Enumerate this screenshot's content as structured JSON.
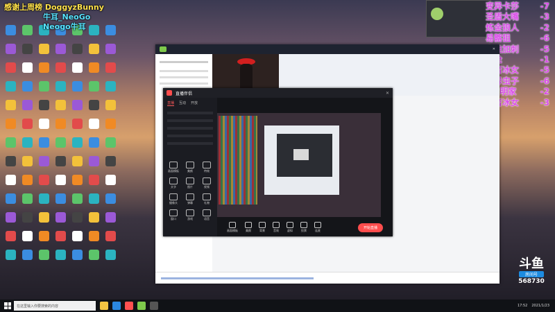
{
  "overlay": {
    "line1": "感谢上周榜 DoggyzBunny",
    "line2": "牛耳_NeoGo",
    "line3": "Neogo牛耳"
  },
  "ranking": [
    {
      "name": "变异卡莎",
      "score": "-7"
    },
    {
      "name": "圣盾大嘴",
      "score": "-3"
    },
    {
      "name": "炼金狼人",
      "score": "-2"
    },
    {
      "name": "易髂狙",
      "score": "-6"
    },
    {
      "name": "辛迪加刺",
      "score": "-5"
    },
    {
      "name": "斗枪",
      "score": "-1"
    },
    {
      "name": "学者冰女",
      "score": "-5"
    },
    {
      "name": "变异虫子",
      "score": "-6"
    },
    {
      "name": "7发明家",
      "score": "-2"
    },
    {
      "name": "学者冰女",
      "score": "-3"
    }
  ],
  "live_app": {
    "title": "直播伴侣",
    "tabs": [
      "直播",
      "互动",
      "开放"
    ],
    "tools": [
      "画面模板",
      "美颜",
      "特效",
      "文字",
      "图片",
      "视频",
      "摄像头",
      "弹幕",
      "礼物",
      "窗口",
      "游戏",
      "语音"
    ],
    "bottom_items": [
      "画面模板",
      "美颜",
      "背景",
      "音效",
      "虚拟",
      "投票",
      "连麦"
    ],
    "go_live": "开始直播"
  },
  "douyu": {
    "logo": "斗鱼",
    "room_label": "房间号",
    "room_number": "568730"
  },
  "taskbar": {
    "search_placeholder": "在这里输入你要搜索的内容",
    "time": "17:52",
    "date": "2021/1/23"
  },
  "colors": {
    "rank": "#d94be8",
    "accent": "#ff4d4d",
    "douyu_blue": "#1d8be0"
  }
}
